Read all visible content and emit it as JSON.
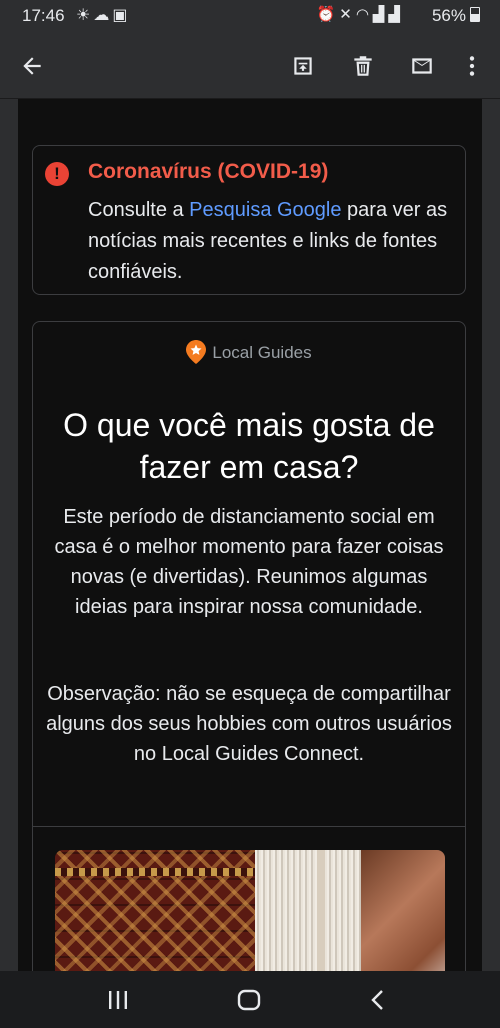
{
  "status_bar": {
    "time": "17:46",
    "left_icons": [
      "weather-icon",
      "cloud-icon",
      "notification-icon"
    ],
    "right_icons": [
      "alarm-icon",
      "mute-icon",
      "wifi-icon",
      "signal-icon",
      "signal-icon"
    ],
    "battery": "56%",
    "battery_level": 0.56
  },
  "toolbar": {
    "actions": [
      "back-arrow-icon",
      "archive-icon",
      "delete-icon",
      "mail-icon",
      "more-vert-icon"
    ]
  },
  "covid_notice": {
    "title": "Coronavírus (COVID-19)",
    "text_before": "Consulte a ",
    "link_text": "Pesquisa Google",
    "text_after": " para ver as notícias mais recentes e links de fontes confiáveis.",
    "title_color": "#f25c4a",
    "link_color": "#5f9bff"
  },
  "local_guides": {
    "brand": "Local Guides",
    "brand_color": "#f47b20",
    "heading": "O que você mais gosta de fazer em casa?",
    "paragraph1": "Este período de distanciamento social em casa é o melhor momento para fazer coisas novas (e divertidas). Reunimos algumas ideias para inspirar nossa comunidade.",
    "paragraph2": "Observação: não se esqueça de compartilhar alguns dos seus hobbies com outros usuários no Local Guides Connect."
  },
  "nav_bar": {
    "buttons": [
      "recent-apps-icon",
      "home-icon",
      "back-icon"
    ]
  }
}
